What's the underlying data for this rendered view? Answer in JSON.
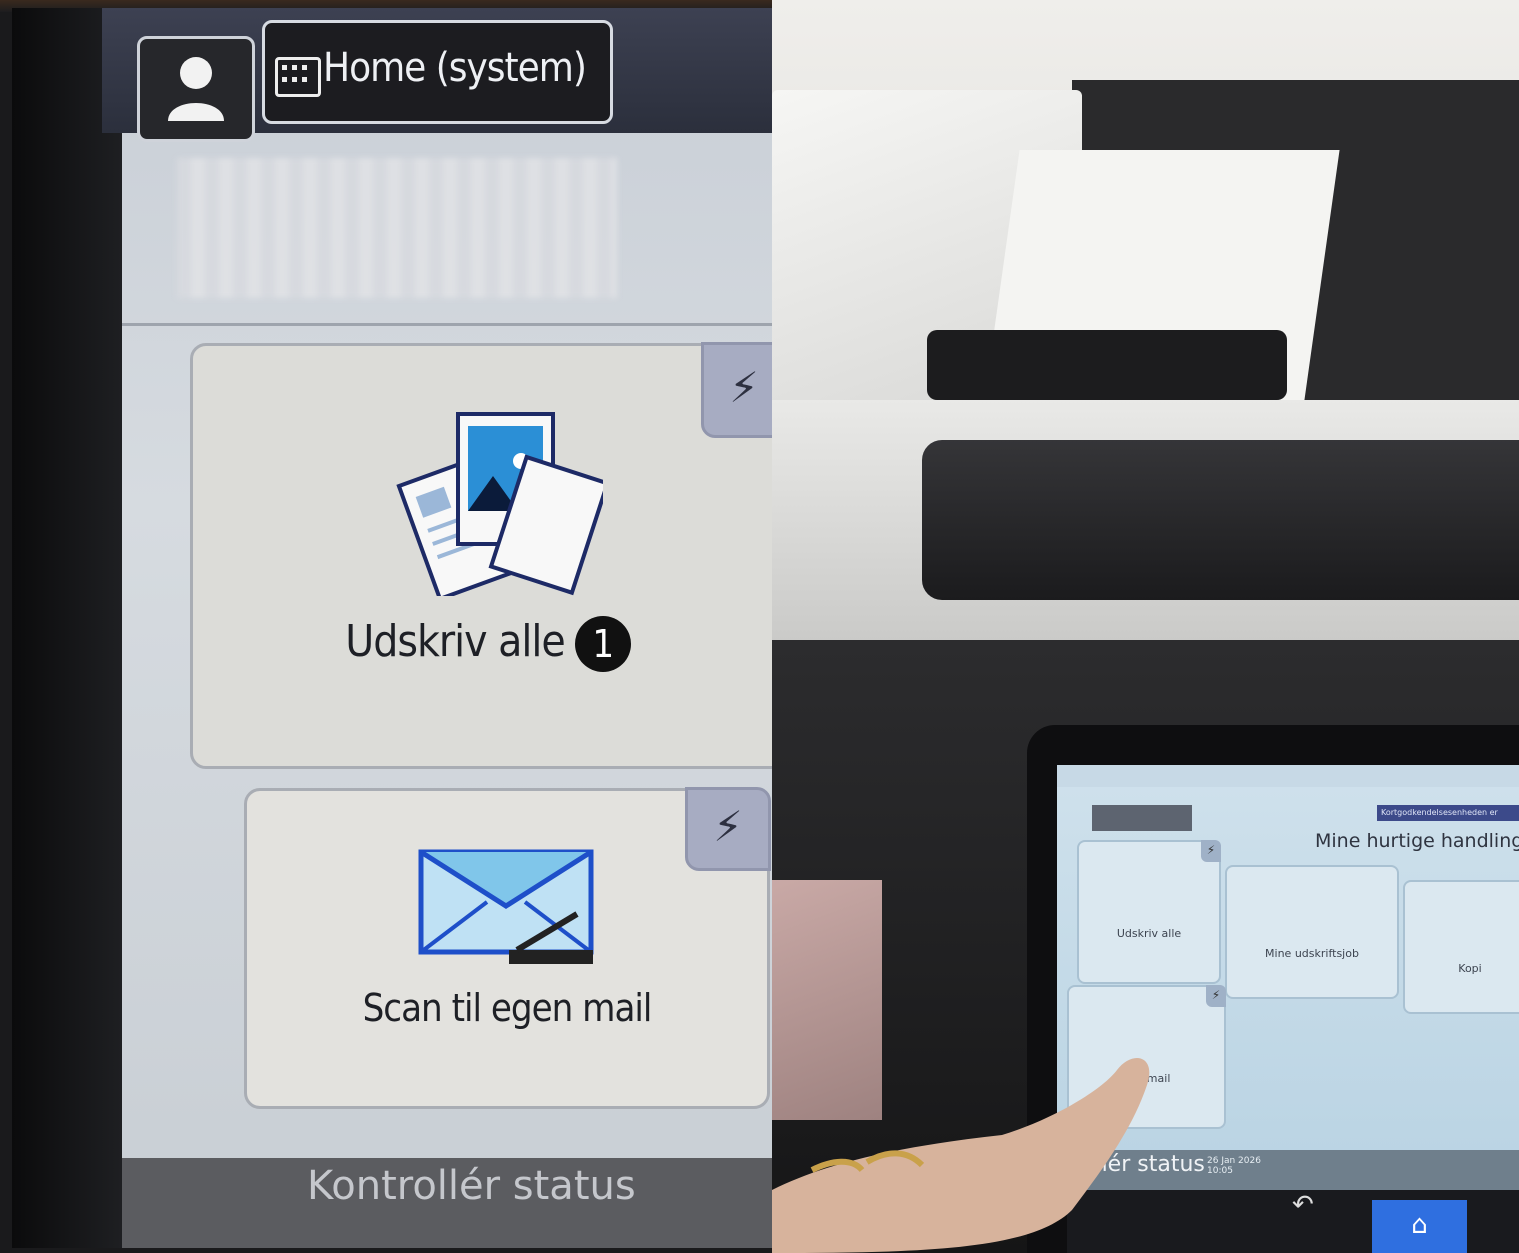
{
  "left_panel": {
    "home_label": "Home (system)",
    "tiles": [
      {
        "label": "Udskriv alle",
        "badge": "1",
        "quick_icon": "lightning-icon",
        "icon": "print-documents-icon"
      },
      {
        "label": "Scan til egen mail",
        "quick_icon": "lightning-icon",
        "icon": "envelope-scanner-icon"
      }
    ],
    "status_label": "Kontrollér status"
  },
  "right_panel": {
    "banner": "Kortgodkendelsesenheden er",
    "section_title": "Mine hurtige handlinger",
    "tiles": [
      {
        "label": "Udskriv alle"
      },
      {
        "label": "Mine udskriftsjob"
      },
      {
        "label": "Kopi"
      },
      {
        "label": "gen mail"
      }
    ],
    "status_label": "ollér status",
    "date": "26 Jan 2026",
    "time": "10:05"
  },
  "colors": {
    "lightning_tile": "#a7acc2",
    "home_hw_button": "#2f6fe0",
    "screen_bg": "#d6dbe0"
  }
}
